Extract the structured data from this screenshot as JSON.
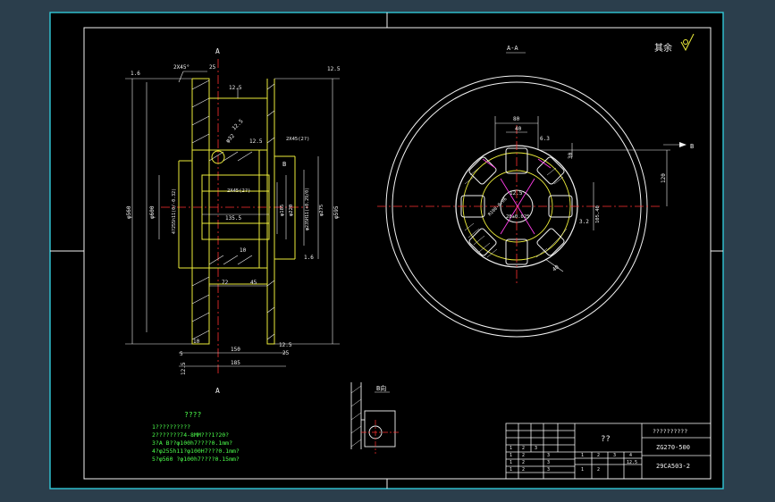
{
  "drawing": {
    "roughness_label": "其余",
    "section_label": "A-A",
    "section_mark_top": "A",
    "section_mark_bottom": "A",
    "view_b_arrow_label": "B",
    "detail_b_label": "B向",
    "tech_req_title": "????",
    "tech_req_lines": [
      "1??????????",
      "2???????74-8MM???1?20?",
      "3?A B??φ100h7????0.1mm?",
      "4?φ255h11?φ100H7???0.1mm?",
      "5?φ560 ?φ100h7????0.15mm?"
    ]
  },
  "side_view_dims": {
    "top_left_ra": "1.6",
    "top_chamfer": "2X45°",
    "top_width": "25",
    "top_right_ra": "12.5",
    "left_col_dia_560": "φ560",
    "left_col_dia_600": "φ600",
    "bore_fit": "4?255h11(0/-0.32)",
    "web_ra": "12.5",
    "hole_dia": "φ32",
    "hole_ra": "12.5",
    "chamfer_right": "2X45(2?)",
    "label_b_side": "B",
    "mid_chamfer": "2X45(2?)",
    "mid_ra": "12.5",
    "hub_len": "135.5",
    "hub_dia_185": "φ185",
    "hub_dia_220": "φ220",
    "hub_dia_275": "φ275",
    "hub_fit": "φ235H11(+0.29/0)",
    "right_dia": "φ595",
    "small_10": "10",
    "right_ra_low": "1.6",
    "dim_72": "72",
    "dim_45": "45",
    "dim_10b": "10",
    "dim_5": "5",
    "dim_150": "150",
    "ra_150": "25",
    "dim_185": "185",
    "ra_bottom_left": "12.5",
    "ra_bottom_right": "12.5"
  },
  "front_view_dims": {
    "dim_80": "80",
    "dim_40": "40",
    "ra_top": "6.3",
    "dim_30": "30",
    "dim_120": "120",
    "dim_r": "R100-0.06",
    "ra_mid": "12.5",
    "dim_bore": "28±0.025",
    "dim_side": "105.40",
    "ra_right": "3.2",
    "dim_40b": "40"
  },
  "title_block": {
    "part_name": "??",
    "company": "??????????",
    "drawing_no": "ZG270-500",
    "code": "29CA503-2",
    "rows": [
      [
        "1",
        "2",
        "3"
      ],
      [
        "1",
        "2",
        "3"
      ],
      [
        "1",
        "2",
        "3"
      ],
      [
        "1",
        "2",
        "3"
      ]
    ],
    "scale_cells": [
      "1",
      "2",
      "3",
      "4",
      "12.5"
    ],
    "lower_cells": [
      "1",
      "2"
    ]
  }
}
